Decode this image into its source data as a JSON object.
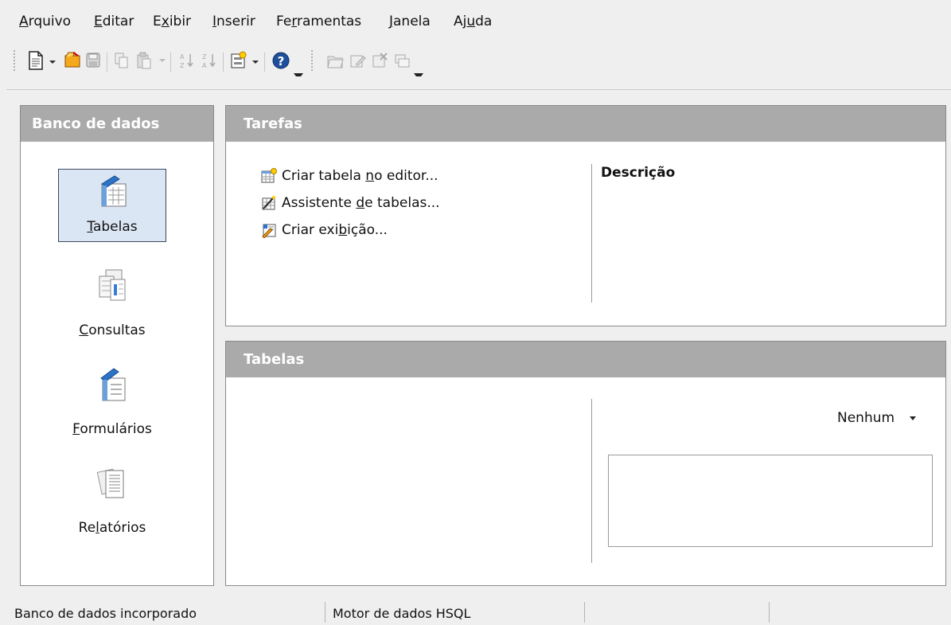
{
  "menu": [
    {
      "pre": "",
      "key": "A",
      "post": "rquivo"
    },
    {
      "pre": "",
      "key": "E",
      "post": "ditar"
    },
    {
      "pre": "E",
      "key": "x",
      "post": "ibir"
    },
    {
      "pre": "",
      "key": "I",
      "post": "nserir"
    },
    {
      "pre": "Fe",
      "key": "r",
      "post": "ramentas"
    },
    {
      "pre": "",
      "key": "J",
      "post": "anela"
    },
    {
      "pre": "Aj",
      "key": "u",
      "post": "da"
    }
  ],
  "toolbar": {
    "icons": [
      "new-document-icon",
      "open-folder-icon",
      "save-icon",
      "copy-icon",
      "paste-icon",
      "sort-ascending-icon",
      "sort-descending-icon",
      "form-icon",
      "help-icon",
      "open-db-object-icon",
      "edit-icon",
      "delete-icon",
      "rename-icon"
    ]
  },
  "nav": {
    "title": "Banco de dados",
    "items": [
      {
        "pre": "",
        "key": "T",
        "post": "abelas",
        "icon": "tables-icon",
        "selected": true
      },
      {
        "pre": "",
        "key": "C",
        "post": "onsultas",
        "icon": "queries-icon",
        "selected": false
      },
      {
        "pre": "",
        "key": "F",
        "post": "ormulários",
        "icon": "forms-icon",
        "selected": false
      },
      {
        "pre": "Re",
        "key": "l",
        "post": "atórios",
        "icon": "reports-icon",
        "selected": false
      }
    ]
  },
  "tasks": {
    "title": "Tarefas",
    "items": [
      {
        "pre": "Criar tabela ",
        "key": "n",
        "post": "o editor...",
        "icon": "table-design-icon"
      },
      {
        "pre": "Assistente ",
        "key": "d",
        "post": "e tabelas...",
        "icon": "table-wizard-icon"
      },
      {
        "pre": "Criar exi",
        "key": "b",
        "post": "ição...",
        "icon": "view-design-icon"
      }
    ],
    "description_label": "Descrição"
  },
  "tables": {
    "title": "Tabelas",
    "preview_select": "Nenhum"
  },
  "status": {
    "db_type": "Banco de dados incorporado",
    "engine": "Motor de dados HSQL"
  },
  "colors": {
    "panel_header": "#aaaaaa",
    "selection": "#dbe6f4"
  }
}
